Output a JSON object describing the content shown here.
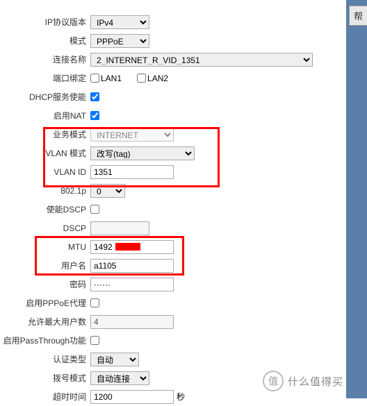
{
  "help_button": "帮",
  "labels": {
    "ip_version": "IP协议版本",
    "mode": "模式",
    "conn_name": "连接名称",
    "port_bind": "端口绑定",
    "dhcp_enable": "DHCP服务使能",
    "nat_enable": "启用NAT",
    "service_mode": "业务模式",
    "vlan_mode": "VLAN 模式",
    "vlan_id": "VLAN ID",
    "p8021": "802.1p",
    "dscp_enable": "使能DSCP",
    "dscp": "DSCP",
    "mtu": "MTU",
    "username": "用户名",
    "password": "密码",
    "pppoe_proxy": "启用PPPoE代理",
    "max_users": "允许最大用户数",
    "passthrough": "启用PassThrough功能",
    "auth_type": "认证类型",
    "dial_mode": "拨号模式",
    "timeout": "超时时间",
    "seconds": "秒"
  },
  "values": {
    "ip_version": "IPv4",
    "mode": "PPPoE",
    "conn_name": "2_INTERNET_R_VID_1351",
    "lan1": "LAN1",
    "lan2": "LAN2",
    "service_mode": "INTERNET",
    "vlan_mode": "改写(tag)",
    "vlan_id": "1351",
    "p8021": "0",
    "dscp": "",
    "mtu": "1492",
    "username": "a1105",
    "password": "······",
    "max_users": "4",
    "auth_type": "自动",
    "dial_mode": "自动连接",
    "timeout": "1200"
  },
  "watermark": {
    "circle": "值",
    "text": "什么值得买"
  }
}
